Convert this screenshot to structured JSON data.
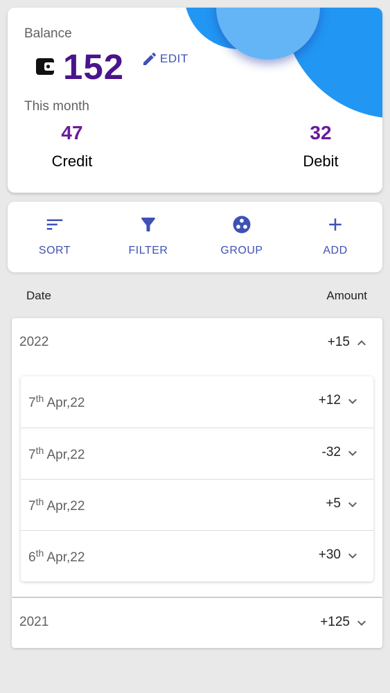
{
  "balance_card": {
    "balance_label": "Balance",
    "balance_value": "152",
    "edit_label": "EDIT",
    "month_label": "This month",
    "credit_value": "47",
    "credit_label": "Credit",
    "debit_value": "32",
    "debit_label": "Debit"
  },
  "actions": {
    "sort": "SORT",
    "filter": "FILTER",
    "group": "GROUP",
    "add": "ADD"
  },
  "list_header": {
    "date": "Date",
    "amount": "Amount"
  },
  "groups": [
    {
      "year": "2022",
      "total": "+15",
      "expanded": true,
      "transactions": [
        {
          "day": "7",
          "suffix": "th",
          "month": "Apr,22",
          "amount": "+12"
        },
        {
          "day": "7",
          "suffix": "th",
          "month": "Apr,22",
          "amount": "-32"
        },
        {
          "day": "7",
          "suffix": "th",
          "month": "Apr,22",
          "amount": "+5"
        },
        {
          "day": "6",
          "suffix": "th",
          "month": "Apr,22",
          "amount": "+30"
        }
      ]
    },
    {
      "year": "2021",
      "total": "+125",
      "expanded": false
    }
  ],
  "colors": {
    "accent": "#3f51b5",
    "balance": "#4a148c",
    "stats": "#6a1b9a",
    "blob": "#2196f3",
    "blob_light": "#64b5f6"
  },
  "icons": {
    "wallet": "wallet-icon",
    "edit": "pencil-icon",
    "sort": "sort-icon",
    "filter": "filter-icon",
    "group": "group-icon",
    "add": "plus-icon",
    "expand": "chevron-down-icon",
    "collapse": "chevron-up-icon"
  }
}
